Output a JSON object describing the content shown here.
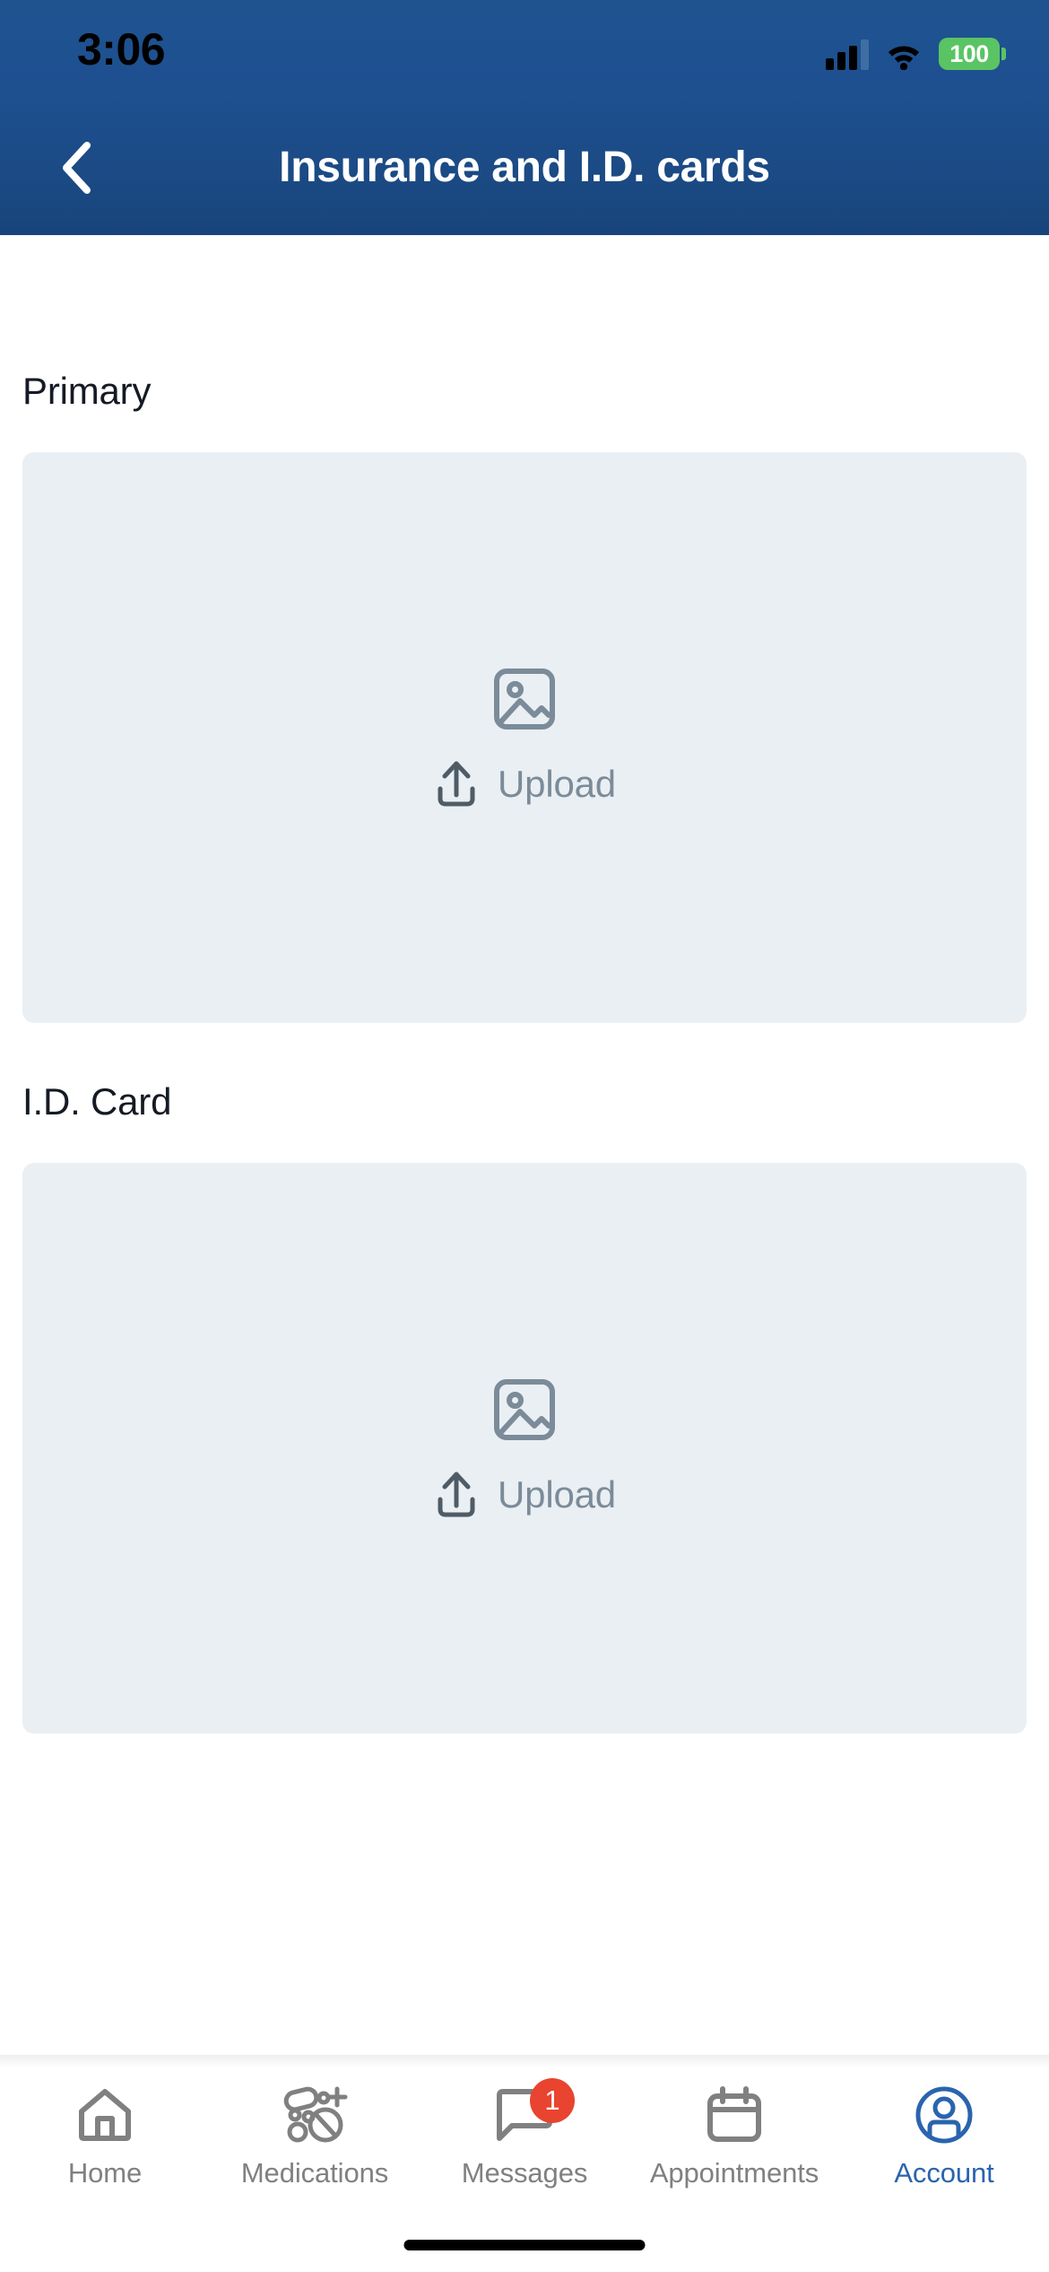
{
  "status_bar": {
    "time": "3:06",
    "battery_percent": "100",
    "cellular_icon": "cellular-signal-icon",
    "wifi_icon": "wifi-icon",
    "battery_icon": "battery-icon",
    "battery_color": "#5ac464"
  },
  "header": {
    "title": "Insurance and I.D. cards",
    "back_icon": "chevron-left-icon",
    "background_color": "#1e5091",
    "title_color": "#ffffff"
  },
  "main": {
    "sections": [
      {
        "label": "Primary",
        "upload_label": "Upload",
        "placeholder_icon": "image-placeholder-icon",
        "upload_icon": "upload-arrow-icon",
        "card_color": "#eaeff3"
      },
      {
        "label": "I.D. Card",
        "upload_label": "Upload",
        "placeholder_icon": "image-placeholder-icon",
        "upload_icon": "upload-arrow-icon",
        "card_color": "#eaeff3"
      }
    ]
  },
  "tab_bar": {
    "active_color": "#2a64ad",
    "inactive_color": "#808080",
    "badge_color": "#e8442f",
    "items": [
      {
        "label": "Home",
        "icon": "home-icon",
        "active": false,
        "badge": ""
      },
      {
        "label": "Medications",
        "icon": "pills-icon",
        "active": false,
        "badge": ""
      },
      {
        "label": "Messages",
        "icon": "message-bubble-icon",
        "active": false,
        "badge": "1"
      },
      {
        "label": "Appointments",
        "icon": "calendar-icon",
        "active": false,
        "badge": ""
      },
      {
        "label": "Account",
        "icon": "user-circle-icon",
        "active": true,
        "badge": ""
      }
    ]
  }
}
